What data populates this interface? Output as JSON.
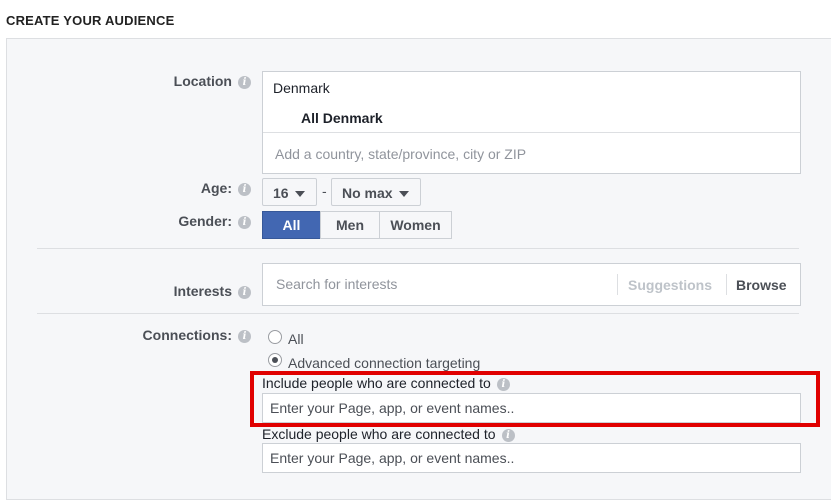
{
  "header": {
    "title": "CREATE YOUR AUDIENCE"
  },
  "location": {
    "label": "Location",
    "country": "Denmark",
    "region": "All Denmark",
    "placeholder": "Add a country, state/province, city or ZIP"
  },
  "age": {
    "label": "Age:",
    "min": "16",
    "separator": "-",
    "max": "No max"
  },
  "gender": {
    "label": "Gender:",
    "options": [
      "All",
      "Men",
      "Women"
    ],
    "selected": "All"
  },
  "interests": {
    "label": "Interests",
    "placeholder": "Search for interests",
    "suggestions": "Suggestions",
    "browse": "Browse"
  },
  "connections": {
    "label": "Connections:",
    "option_all": "All",
    "option_advanced": "Advanced connection targeting",
    "selected": "Advanced connection targeting",
    "include_label": "Include people who are connected to",
    "include_placeholder": "Enter your Page, app, or event names..",
    "exclude_label": "Exclude people who are connected to",
    "exclude_placeholder": "Enter your Page, app, or event names.."
  },
  "colors": {
    "accent": "#4267b2",
    "highlight": "#e00000"
  },
  "icons": {
    "info": "info-icon",
    "dropdown": "caret-down-icon"
  }
}
